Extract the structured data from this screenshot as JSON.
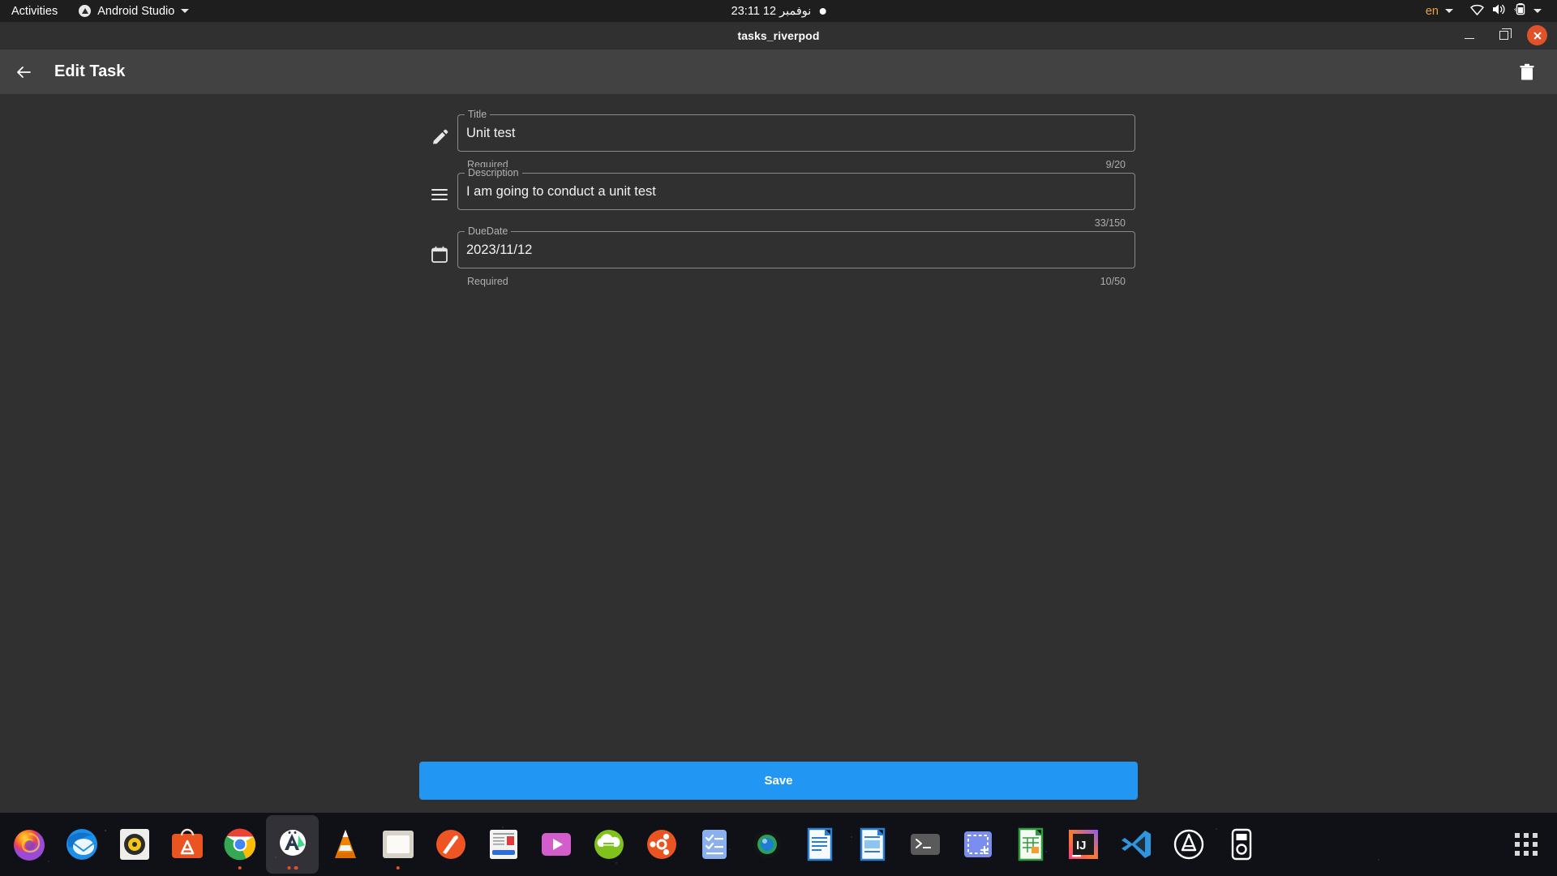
{
  "topbar": {
    "activities": "Activities",
    "app_name": "Android Studio",
    "app_icon": "android-studio-icon",
    "clock": "23:11 نوفمبر 12",
    "notification_dot": "notification-dot",
    "language": "en",
    "tray_icons": [
      "wifi-icon",
      "volume-icon",
      "battery-charging-icon",
      "chevron-down-icon"
    ]
  },
  "window": {
    "title": "tasks_riverpod",
    "controls": {
      "minimize": "minimize-button",
      "maximize": "maximize-button",
      "close": "close-button"
    }
  },
  "appbar": {
    "back_icon": "back-arrow-icon",
    "title": "Edit Task",
    "delete_icon": "delete-icon"
  },
  "form": {
    "fields": [
      {
        "icon": "pencil-icon",
        "label": "Title",
        "value": "Unit test",
        "helper": "Required",
        "counter": "9/20"
      },
      {
        "icon": "list-icon",
        "label": "Description",
        "value": "I am going to conduct a unit test",
        "helper": "",
        "counter": "33/150"
      },
      {
        "icon": "calendar-icon",
        "label": "DueDate",
        "value": "2023/11/12",
        "helper": "Required",
        "counter": "10/50"
      }
    ]
  },
  "save_button": {
    "label": "Save",
    "color": "#2196f3"
  },
  "dock": {
    "items": [
      {
        "name": "firefox",
        "running": false,
        "active": false
      },
      {
        "name": "thunderbird",
        "running": false,
        "active": false
      },
      {
        "name": "rhythmbox",
        "running": false,
        "active": false
      },
      {
        "name": "ubuntu-software",
        "running": false,
        "active": false
      },
      {
        "name": "google-chrome",
        "running": true,
        "active": false
      },
      {
        "name": "android-studio",
        "running": true,
        "active": true
      },
      {
        "name": "vlc",
        "running": false,
        "active": false
      },
      {
        "name": "files",
        "running": true,
        "active": false
      },
      {
        "name": "gimp",
        "running": false,
        "active": false
      },
      {
        "name": "news-reader",
        "running": false,
        "active": false
      },
      {
        "name": "video-player",
        "running": false,
        "active": false
      },
      {
        "name": "nextcloud",
        "running": false,
        "active": false
      },
      {
        "name": "ubuntu",
        "running": false,
        "active": false
      },
      {
        "name": "tasks",
        "running": false,
        "active": false
      },
      {
        "name": "camera",
        "running": false,
        "active": false
      },
      {
        "name": "libreoffice-writer",
        "running": false,
        "active": false
      },
      {
        "name": "libreoffice-impress",
        "running": false,
        "active": false
      },
      {
        "name": "terminal",
        "running": false,
        "active": false
      },
      {
        "name": "screenshot",
        "running": false,
        "active": false
      },
      {
        "name": "libreoffice-calc",
        "running": false,
        "active": false
      },
      {
        "name": "intellij-idea",
        "running": false,
        "active": false
      },
      {
        "name": "vs-code",
        "running": false,
        "active": false
      },
      {
        "name": "app-center",
        "running": false,
        "active": false
      },
      {
        "name": "device-manager",
        "running": false,
        "active": false
      }
    ],
    "show_apps": "show-applications-icon"
  },
  "colors": {
    "accent": "#2196f3",
    "window_bg": "#303030",
    "appbar_bg": "#424242",
    "close_btn": "#e0522a"
  }
}
